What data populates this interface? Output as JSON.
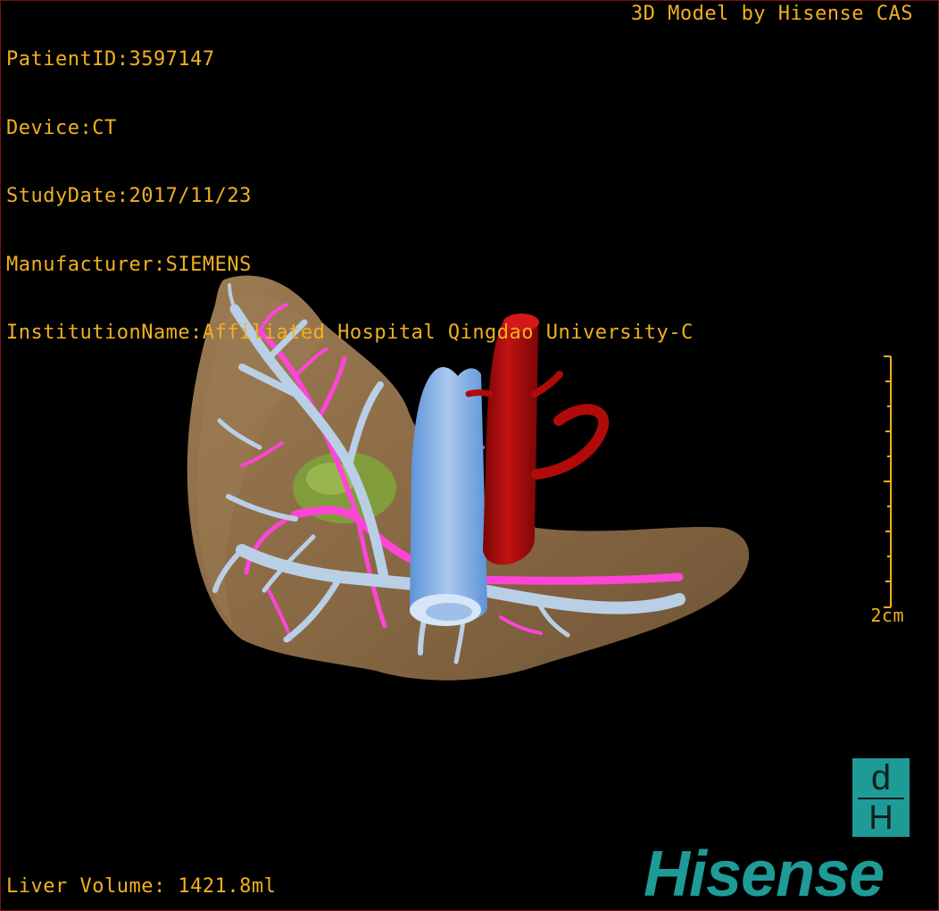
{
  "overlay": {
    "patient_id": "PatientID:3597147",
    "device": "Device:CT",
    "study_date": "StudyDate:2017/11/23",
    "manufacturer": "Manufacturer:SIEMENS",
    "institution": "InstitutionName:Affiliated Hospital Qingdao University-C",
    "credit": "3D Model by Hisense CAS",
    "liver_volume": "Liver Volume: 1421.8ml",
    "scale_label": "2cm"
  },
  "logo": {
    "top_glyph": "d",
    "bottom_glyph": "H",
    "wordmark": "Hisense"
  },
  "colors": {
    "overlay_text": "#f0b020",
    "liver": "#8a6a45",
    "portal_vein": "#b9cfe6",
    "hepatic_artery": "#ff44d8",
    "ivc": "#7fb0ea",
    "aorta": "#b00a0a",
    "tumor": "#7fa43a",
    "brand": "#1e9b96"
  }
}
